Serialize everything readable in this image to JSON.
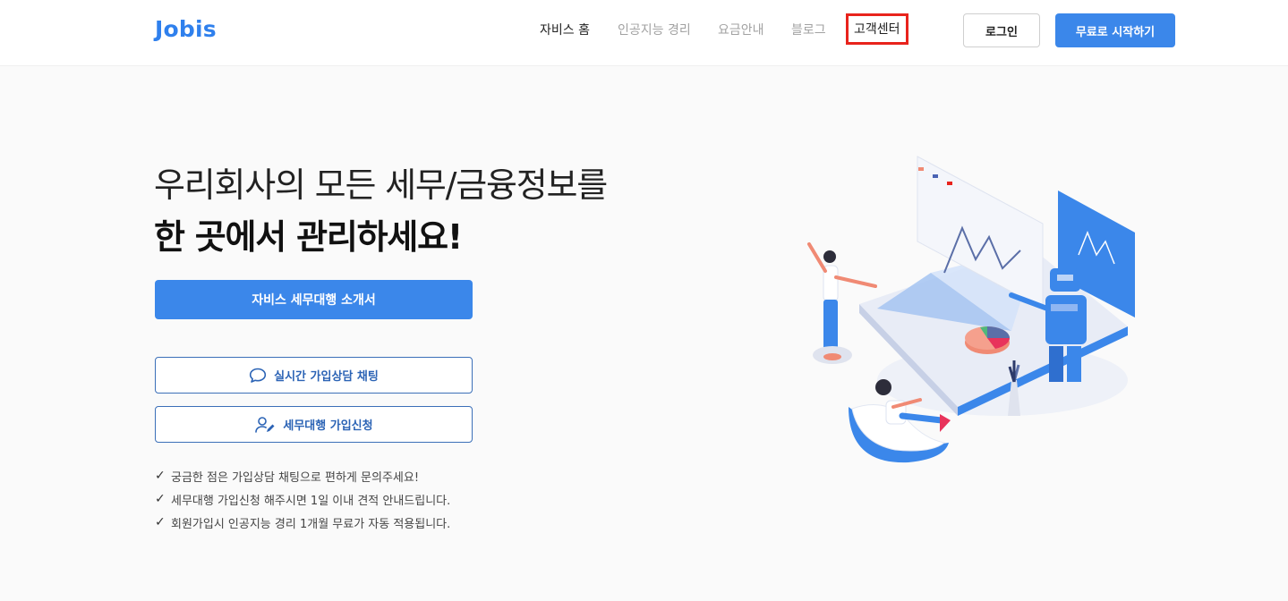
{
  "header": {
    "logo": "Jobis",
    "nav": [
      {
        "label": "자비스 홈",
        "state": "active"
      },
      {
        "label": "인공지능 경리",
        "state": "inactive"
      },
      {
        "label": "요금안내",
        "state": "inactive"
      },
      {
        "label": "블로그",
        "state": "inactive"
      },
      {
        "label": "고객센터",
        "state": "highlighted"
      }
    ],
    "login_label": "로그인",
    "start_label": "무료로 시작하기"
  },
  "hero": {
    "line1": "우리회사의 모든 세무/금융정보를",
    "line2": "한 곳에서 관리하세요!",
    "primary_button": "자비스 세무대행 소개서",
    "chat_button": "실시간 가입상담 채팅",
    "signup_button": "세무대행 가입신청",
    "checks": [
      "궁금한 점은 가입상담 채팅으로 편하게 문의주세요!",
      "세무대행 가입신청 해주시면 1일 이내 견적 안내드립니다.",
      "회원가입시 인공지능 경리 1개월 무료가 자동 적용됩니다."
    ]
  },
  "colors": {
    "brand": "#2f80ed",
    "primary_button": "#3b87ea",
    "highlight_border": "#e8231c"
  },
  "icons": {
    "chat": "speech-bubble-icon",
    "signup": "user-edit-icon",
    "check": "check-icon"
  }
}
